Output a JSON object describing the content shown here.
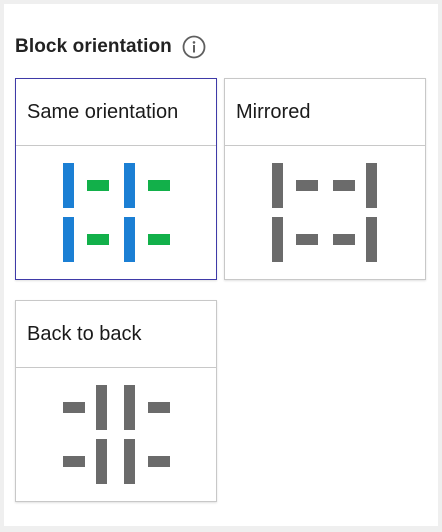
{
  "header": {
    "title": "Block orientation",
    "info_icon": "info-circle-icon"
  },
  "options": [
    {
      "id": "same",
      "label": "Same orientation",
      "selected": true
    },
    {
      "id": "mirrored",
      "label": "Mirrored",
      "selected": false
    },
    {
      "id": "back",
      "label": "Back to back",
      "selected": false
    }
  ],
  "colors": {
    "selected_border": "#3f3aa8",
    "bar_selected": "#1b7fd4",
    "desk_selected": "#12b04a",
    "bar_default": "#6b6b6b",
    "desk_default": "#6b6b6b"
  }
}
